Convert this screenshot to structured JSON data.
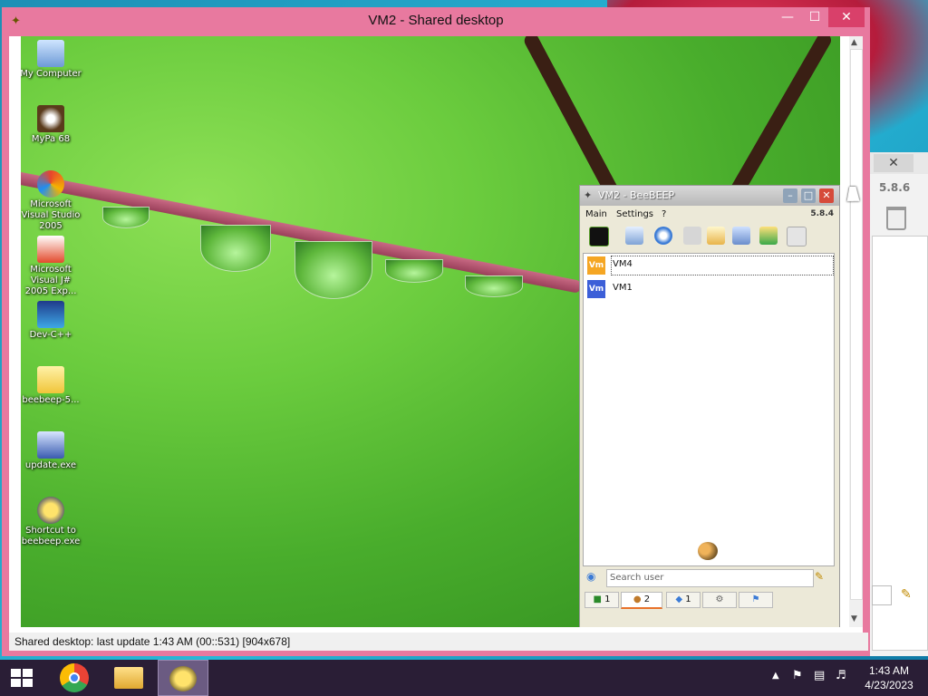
{
  "window": {
    "title": "VM2 - Shared desktop",
    "min": "—",
    "max": "☐",
    "close": "✕"
  },
  "status_bar": "Shared desktop: last update 1:43 AM (00::531) [904x678]",
  "desktop_icons": [
    {
      "label": "My Computer"
    },
    {
      "label": "MyPa 68"
    },
    {
      "label": "Microsoft Visual Studio 2005"
    },
    {
      "label": "Microsoft Visual J# 2005 Exp..."
    },
    {
      "label": "Dev-C++"
    },
    {
      "label": "beebeep-5..."
    },
    {
      "label": "update.exe"
    },
    {
      "label": "Shortcut to beebeep.exe"
    }
  ],
  "beebeep": {
    "title": "VM2 - BeeBEEP",
    "menu": [
      "Main",
      "Settings",
      "?"
    ],
    "version": "5.8.4",
    "users": [
      {
        "name": "VM4",
        "avatar": "Vm",
        "color": "#f5a623"
      },
      {
        "name": "VM1",
        "avatar": "Vm",
        "color": "#3c5fd8"
      }
    ],
    "search_placeholder": "Search user",
    "tabs": [
      {
        "label": "1"
      },
      {
        "label": "2"
      },
      {
        "label": "1"
      },
      {
        "label": ""
      },
      {
        "label": ""
      }
    ]
  },
  "back_window": {
    "version": "5.8.6",
    "close": "✕"
  },
  "taskbar": {
    "time": "1:43 AM",
    "date": "4/23/2023"
  }
}
